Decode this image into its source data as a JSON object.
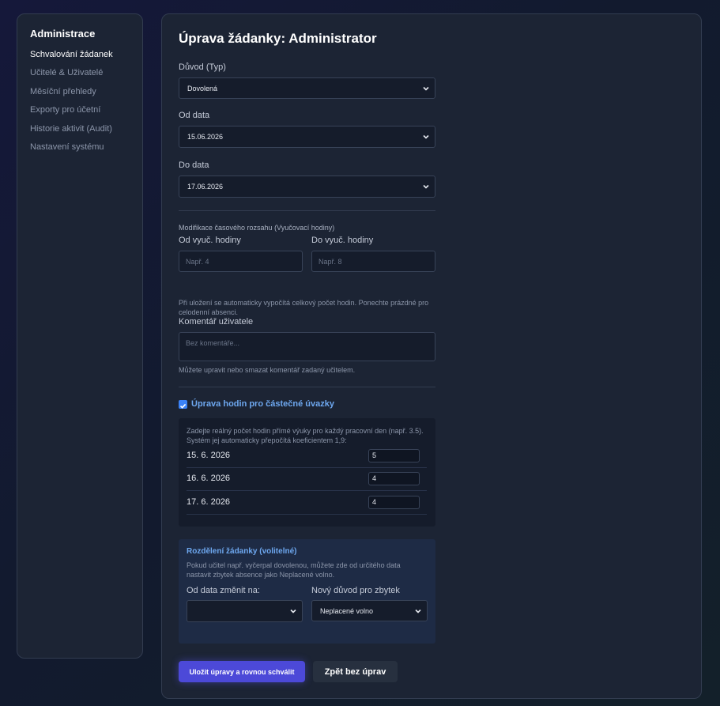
{
  "sidebar": {
    "title": "Administrace",
    "items": [
      {
        "label": "Schvalování žádanek"
      },
      {
        "label": "Učitelé & Uživatelé"
      },
      {
        "label": "Měsíční přehledy"
      },
      {
        "label": "Exporty pro účetní"
      },
      {
        "label": "Historie aktivit (Audit)"
      },
      {
        "label": "Nastavení systému"
      }
    ]
  },
  "form": {
    "title": "Úprava žádanky: Administrator",
    "reason_label": "Důvod (Typ)",
    "reason_value": "Dovolená",
    "from_label": "Od data",
    "from_value": "15.06.2026",
    "to_label": "Do data",
    "to_value": "17.06.2026",
    "time_range_label": "Modifikace časového rozsahu (Vyučovací hodiny)",
    "from_hour_label": "Od vyuč. hodiny",
    "from_hour_placeholder": "Např. 4",
    "to_hour_label": "Do vyuč. hodiny",
    "to_hour_placeholder": "Např. 8",
    "time_hint": "Při uložení se automaticky vypočítá celkový počet hodin. Ponechte prázdné pro celodenní absenci.",
    "comment_label": "Komentář uživatele",
    "comment_placeholder": "Bez komentáře...",
    "comment_hint": "Můžete upravit nebo smazat komentář zadaný učitelem.",
    "partial_checkbox_label": "Úprava hodin pro částečné úvazky",
    "partial_checked": true,
    "partial_hint": "Zadejte reálný počet hodin přímé výuky pro každý pracovní den (např. 3.5). Systém jej automaticky přepočítá koeficientem 1,9:",
    "days": [
      {
        "date": "15. 6. 2026",
        "hours": "5"
      },
      {
        "date": "16. 6. 2026",
        "hours": "4"
      },
      {
        "date": "17. 6. 2026",
        "hours": "4"
      }
    ],
    "split_title": "Rozdělení žádanky (volitelné)",
    "split_hint": "Pokud učitel např. vyčerpal dovolenou, můžete zde od určitého data nastavit zbytek absence jako Neplacené volno.",
    "split_from_label": "Od data změnit na:",
    "split_from_value": "",
    "split_reason_label": "Nový důvod pro zbytek",
    "split_reason_value": "Neplacené volno",
    "save_button": "Uložit úpravy a rovnou schválit",
    "back_button": "Zpět bez úprav"
  },
  "colors": {
    "accent": "#4c49d8",
    "link_blue": "#6ea8f0",
    "panel": "#1c2434",
    "input_bg": "#151c2b"
  }
}
